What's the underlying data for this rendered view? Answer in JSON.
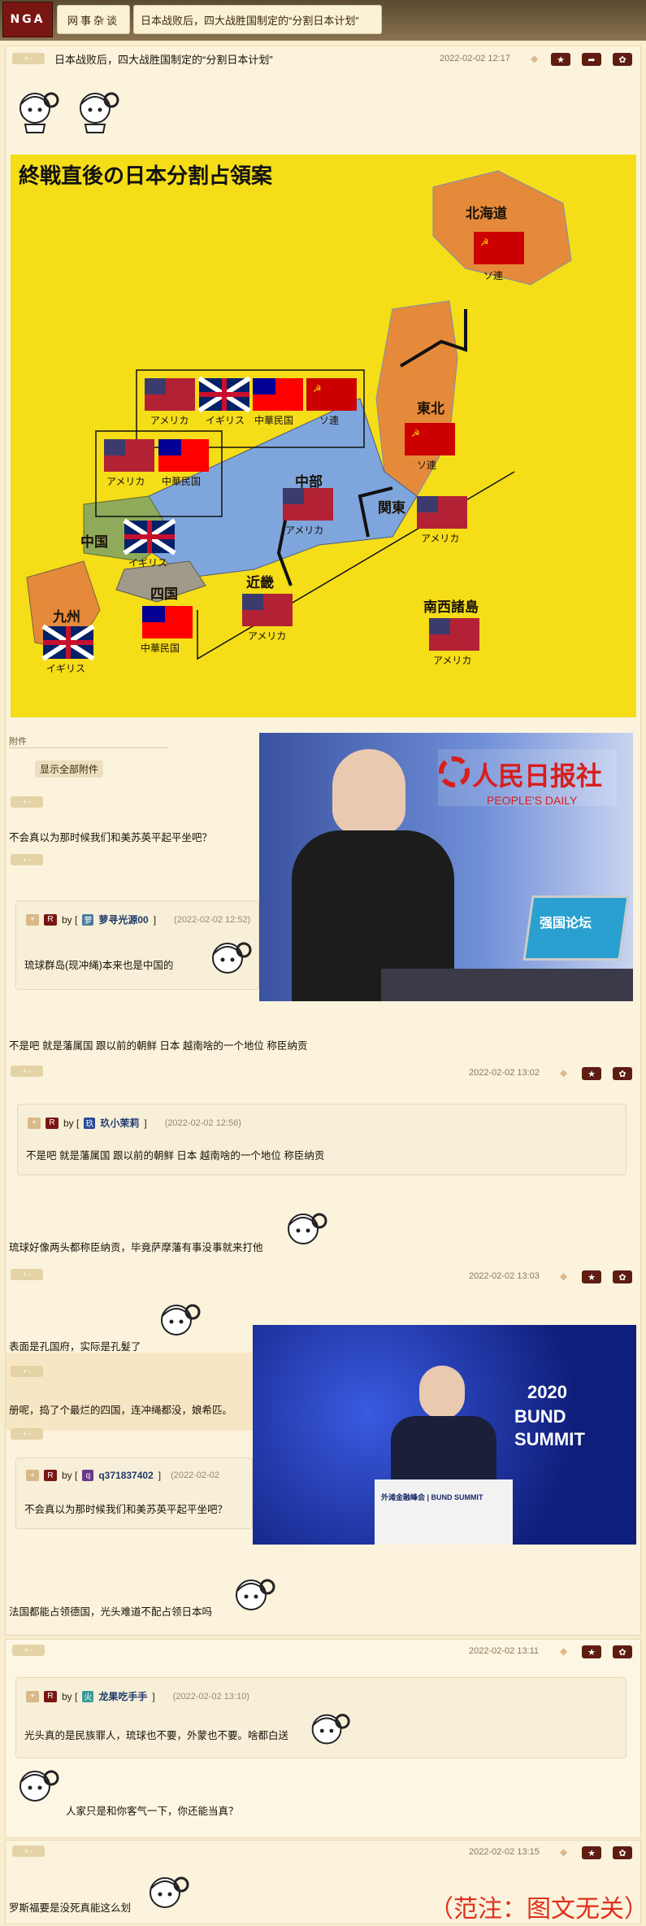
{
  "nav": {
    "logo": "NGA",
    "forum": "网事杂谈",
    "thread_title": "日本战败后，四大战胜国制定的“分割日本计划”"
  },
  "main_post": {
    "vote": "+ -",
    "title": "日本战败后，四大战胜国制定的“分割日本计划”",
    "date": "2022-02-02 12:17",
    "icons": [
      "star-icon",
      "share-icon",
      "gear-icon"
    ]
  },
  "map": {
    "title": "終戦直後の日本分割占領案",
    "regions": {
      "hokkaido": "北海道",
      "tohoku": "東北",
      "chubu": "中部",
      "kanto": "関東",
      "kinki": "近畿",
      "chugoku": "中国",
      "shikoku": "四国",
      "kyushu": "九州",
      "nansei": "南西諸島"
    },
    "countries": {
      "usa": "アメリカ",
      "uk": "イギリス",
      "roc": "中華民国",
      "ussr": "ソ連"
    },
    "colors": {
      "bg": "#f5dd18",
      "north": "#e58a3a",
      "center": "#7fa6dc",
      "west": "#8faa5a",
      "shikoku": "#9f9a8a"
    }
  },
  "attachments": {
    "label": "附件",
    "show_all": "显示全部附件"
  },
  "replies": {
    "r1_text": "不会真以为那时候我们和美苏英平起平坐吧？",
    "q1_user": "萝寻光源00",
    "q1_user_badge": "萝",
    "q1_time": "(2022-02-02 12:52)",
    "q1_text": "琉球群岛(现冲绳)本来也是中国的",
    "r2_text": "不是吧 就是藩属国 跟以前的朝鲜 日本 越南啥的一个地位 称臣纳贡",
    "r2_date": "2022-02-02 13:02",
    "q2_user": "玖小茉莉",
    "q2_user_badge": "玖",
    "q2_time": "(2022-02-02 12:56)",
    "q2_text": "不是吧 就是藩属国 跟以前的朝鲜 日本 越南啥的一个地位 称臣纳贡",
    "r3_text": "琉球好像两头都称臣纳贡，毕竟萨摩藩有事没事就来打他",
    "r4_date": "2022-02-02 13:03",
    "r4_text": "表面是孔国府，实际是孔髮了",
    "r5_text": "册呢，捣了个最烂的四国，连冲绳都没，娘希匹。",
    "q3_user": "q371837402",
    "q3_user_badge": "q",
    "q3_time": "(2022-02-02",
    "q3_text": "不会真以为那时候我们和美苏英平起平坐吧？",
    "r6_text": "法国都能占领德国，光头难道不配占领日本吗",
    "b_date": "2022-02-02 13:11",
    "q4_user": "龙果吃手手",
    "q4_user_badge": "火",
    "q4_time": "(2022-02-02 13:10)",
    "q4_text": "光头真的是民族罪人，琉球也不要，外蒙也不要。啥都白送",
    "b_text": "人家只是和你客气一下，你还能当真？",
    "c_date": "2022-02-02 13:15",
    "c_text": "罗斯福要是没死真能这么划"
  },
  "photo1": {
    "logo_cn": "人民日报社",
    "logo_en": "PEOPLE'S DAILY",
    "screen_text": "强国论坛"
  },
  "photo2": {
    "line1": "2020",
    "line2": "BUND",
    "line3": "SUMMIT",
    "podium": "外滩金融峰会 | BUND SUMMIT"
  },
  "footnote": "（范注：图文无关）"
}
